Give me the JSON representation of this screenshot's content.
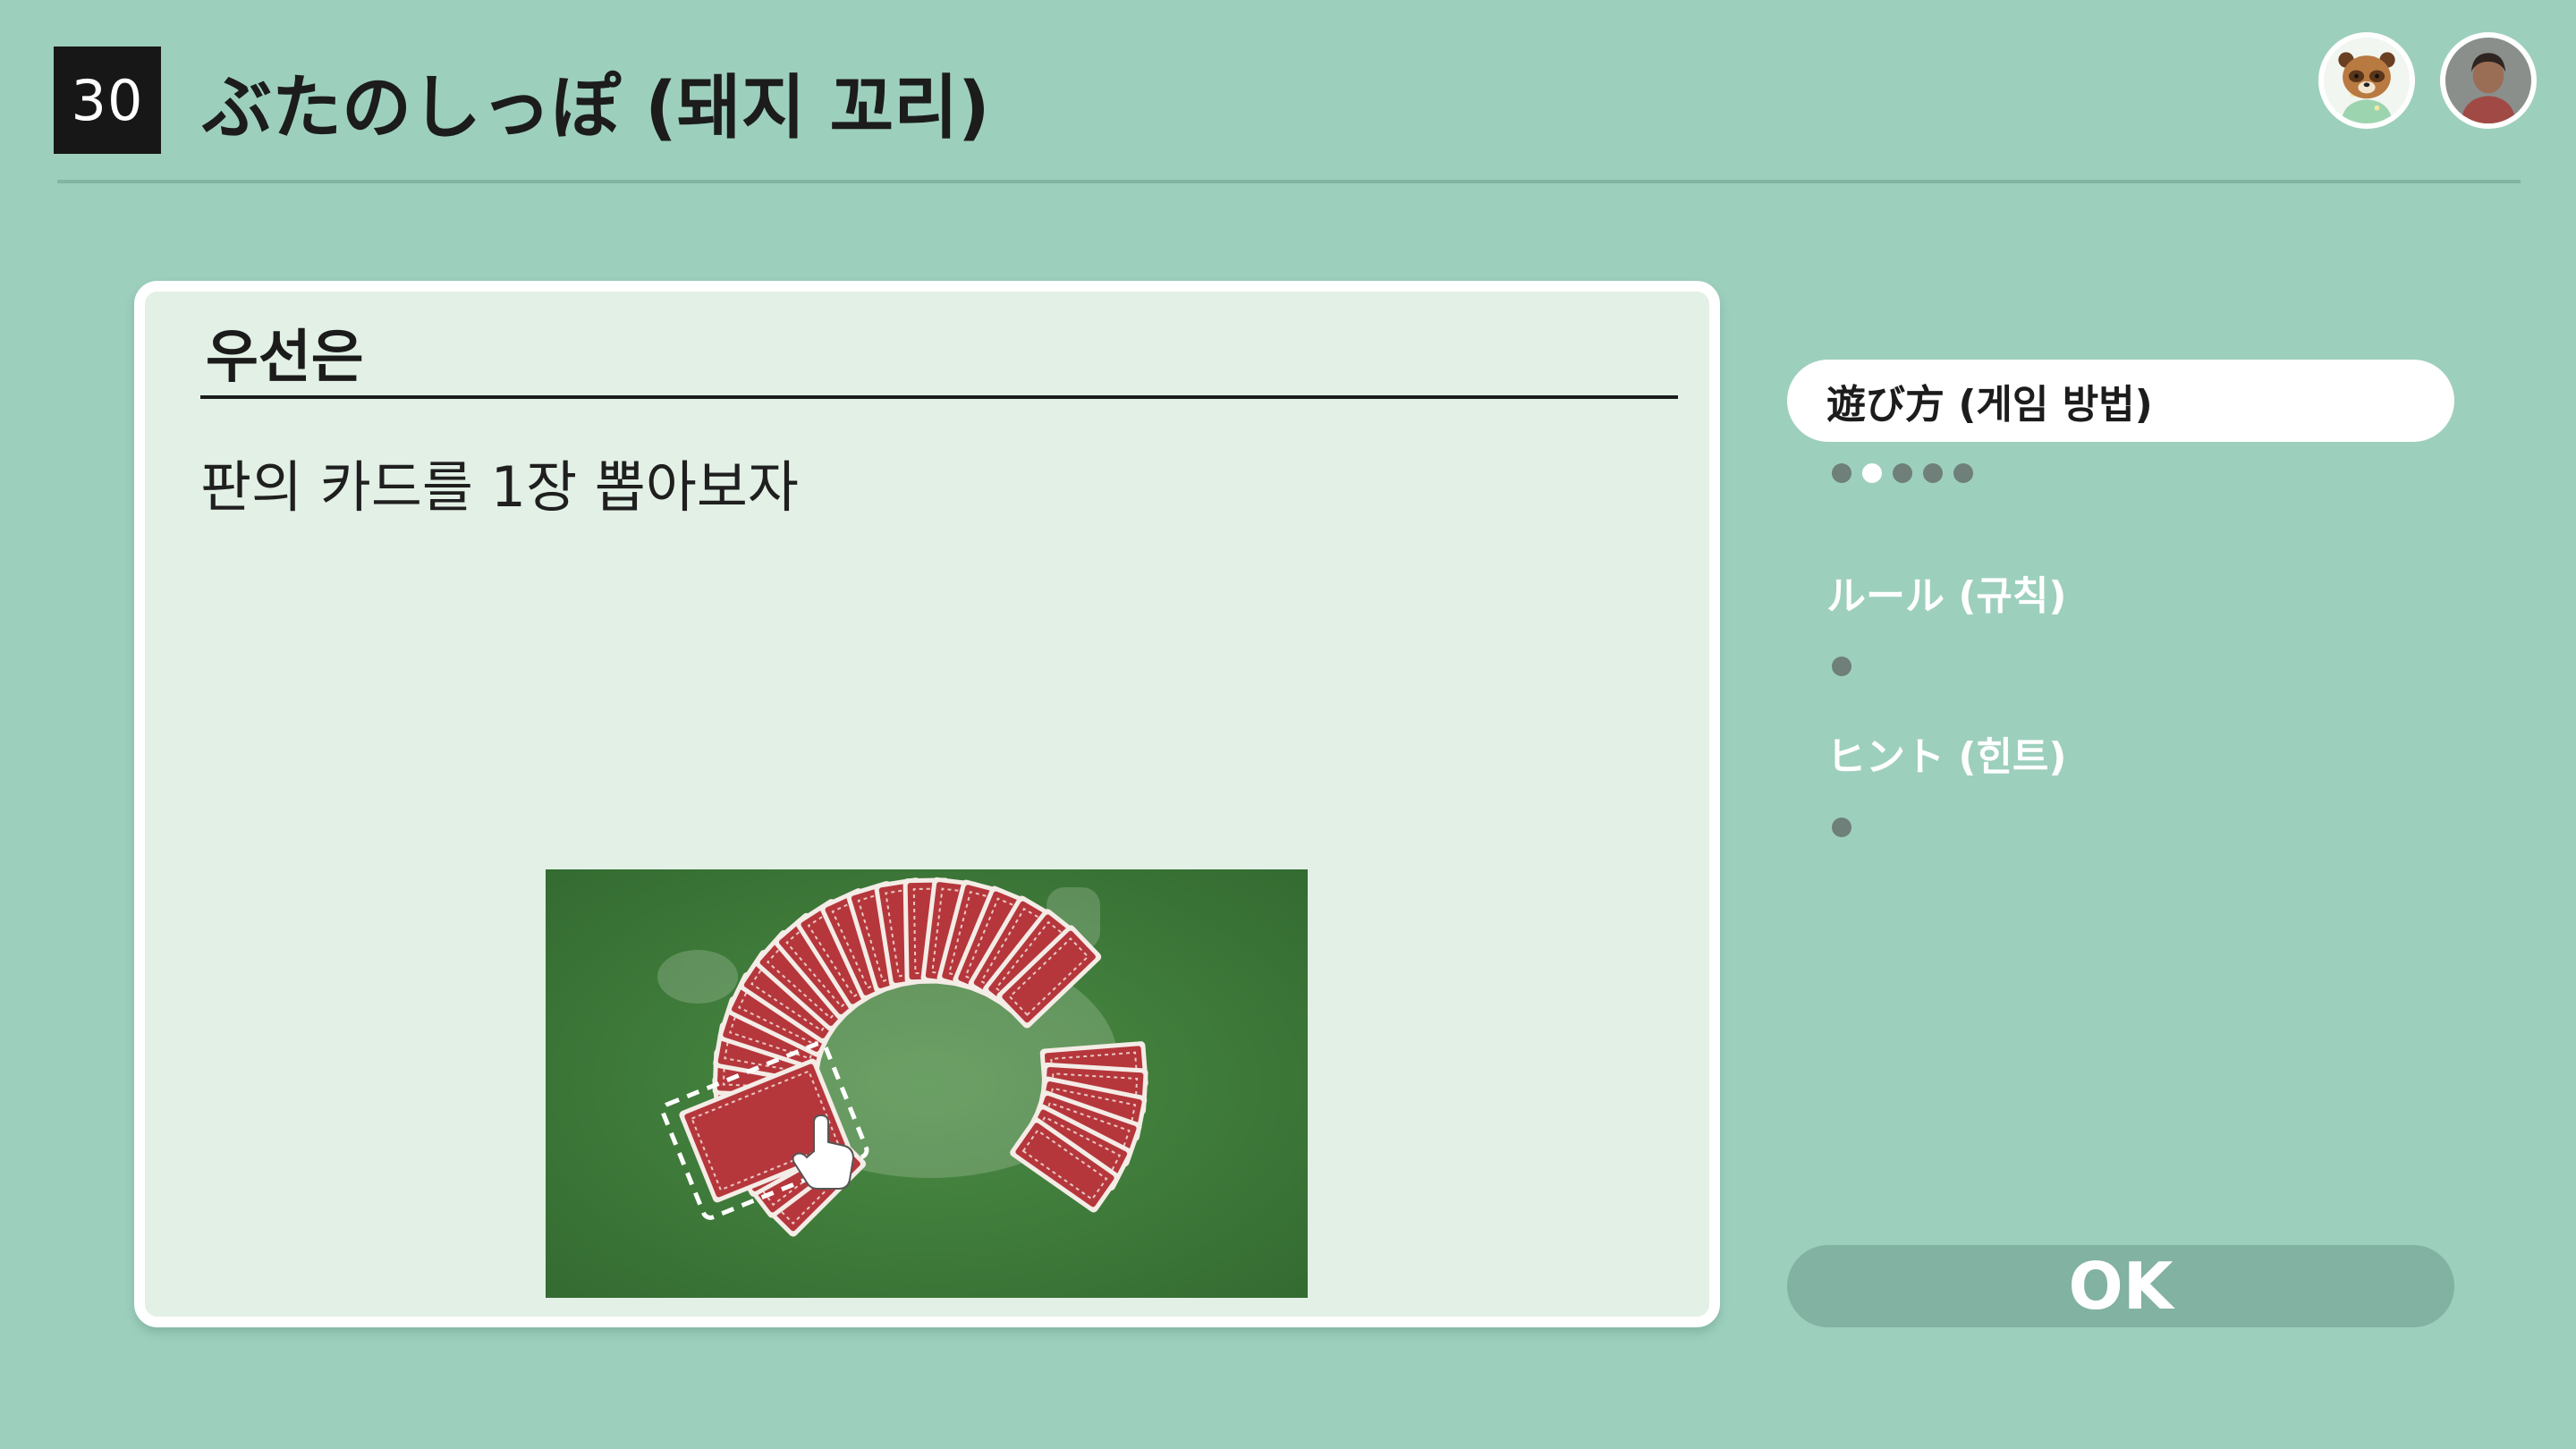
{
  "header": {
    "stage_number": "30",
    "title": "ぶたのしっぽ (돼지 꼬리)"
  },
  "panel": {
    "heading": "우선은",
    "text": "판의 카드를 1장 뽑아보자"
  },
  "menu": {
    "items": [
      {
        "label": "遊び方 (게임 방법)",
        "active": true,
        "pages": 5,
        "current_page": 2
      },
      {
        "label": "ルール (규칙)",
        "active": false,
        "pages": 1,
        "current_page": 0
      },
      {
        "label": "ヒント (힌트)",
        "active": false,
        "pages": 1,
        "current_page": 0
      }
    ]
  },
  "ok_button": {
    "label": "OK"
  },
  "icons": {
    "avatar_left": "tanuki-character-avatar",
    "avatar_right": "user-profile-avatar",
    "pointer": "hand-pointer-icon"
  },
  "colors": {
    "background": "#9dcfbd",
    "panel": "#e2f0e6",
    "table_felt": "#3f7f3c",
    "card_back": "#b5373c"
  }
}
